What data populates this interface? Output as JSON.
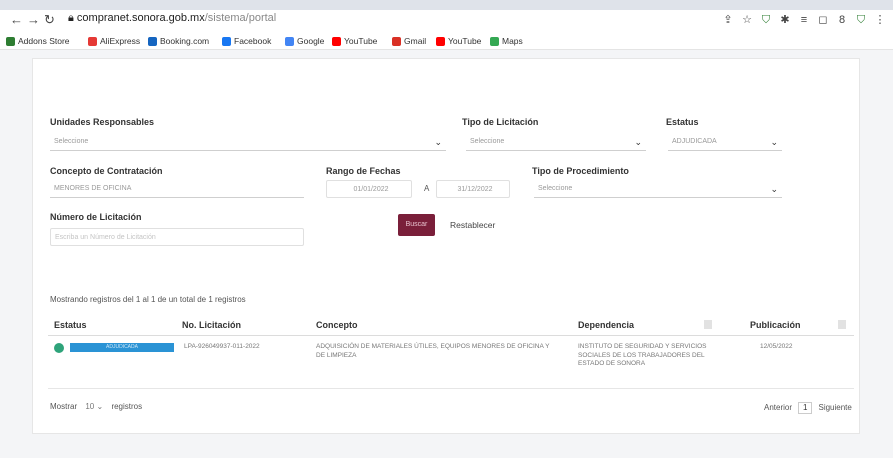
{
  "browser": {
    "url_host": "compranet.sonora.gob.mx",
    "url_path": "/sistema/portal",
    "bookmarks": [
      "Addons Store",
      "AliExpress",
      "Booking.com",
      "Facebook",
      "Google",
      "YouTube",
      "Gmail",
      "YouTube",
      "Maps"
    ],
    "bookmark_colors": [
      "#2e7d32",
      "#e53935",
      "#1565c0",
      "#1877f2",
      "#4285f4",
      "#ff0000",
      "#d93025",
      "#ff0000",
      "#34a853"
    ]
  },
  "filters": {
    "unidades": {
      "label": "Unidades Responsables",
      "value": "Seleccione"
    },
    "tipo_licitacion": {
      "label": "Tipo de Licitación",
      "value": "Seleccione"
    },
    "estatus": {
      "label": "Estatus",
      "value": "ADJUDICADA"
    },
    "concepto": {
      "label": "Concepto de Contratación",
      "value": "MENORES DE OFICINA"
    },
    "rango": {
      "label": "Rango de Fechas",
      "from": "01/01/2022",
      "sep": "A",
      "to": "31/12/2022"
    },
    "tipo_procedimiento": {
      "label": "Tipo de Procedimiento",
      "value": "Seleccione"
    },
    "numero": {
      "label": "Número de Licitación",
      "placeholder": "Escriba un Número de Licitación"
    }
  },
  "buttons": {
    "search": "Buscar",
    "reset": "Restablecer"
  },
  "table": {
    "records_text": "Mostrando registros del 1 al 1 de un total de 1 registros",
    "headers": {
      "estatus": "Estatus",
      "numero": "No. Licitación",
      "concepto": "Concepto",
      "dependencia": "Dependencia",
      "publicacion": "Publicación"
    },
    "rows": [
      {
        "estatus": "ADJUDICADA",
        "numero": "LPA-926049937-011-2022",
        "concepto": "ADQUISICIÓN DE MATERIALES ÚTILES, EQUIPOS MENORES DE OFICINA Y DE LIMPIEZA",
        "dependencia": "INSTITUTO DE SEGURIDAD Y SERVICIOS SOCIALES DE LOS TRABAJADORES DEL ESTADO DE SONORA",
        "publicacion": "12/05/2022"
      }
    ]
  },
  "footer": {
    "mostrar": "Mostrar",
    "page_size": "10",
    "registros": "registros",
    "prev": "Anterior",
    "current_page": "1",
    "next": "Siguiente"
  }
}
